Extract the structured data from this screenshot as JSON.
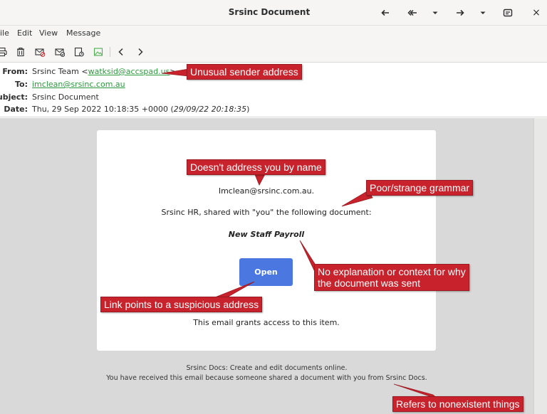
{
  "window": {
    "title": "Srsinc Document",
    "close_glyph": "×"
  },
  "menu": {
    "items": [
      "ile",
      "Edit",
      "View",
      "Message"
    ]
  },
  "headers": {
    "from_label": "From:",
    "from_name": "Srsinc Team <",
    "from_address": "watksid@accspad.us",
    "from_suffix": ">",
    "to_label": "To:",
    "to_address": "imclean@srsinc.com.au",
    "subject_label": "Subject:",
    "subject_value": "Srsinc Document",
    "date_label": "Date:",
    "date_value": "Thu, 29 Sep 2022 10:18:35 +0000 (",
    "date_local": "29/09/22 20:18:35",
    "date_suffix": ")"
  },
  "message": {
    "greeting": "Imclean@srsinc.com.au.",
    "line": "Srsinc HR, shared with \"you\" the following document:",
    "doc_name": "New Staff Payroll",
    "button_label": "Open",
    "grant_text": "This email grants access to this item.",
    "footer_1": "Srsinc Docs: Create and edit documents online.",
    "footer_2": "You have received this email because someone shared a document with you from Srsinc Docs."
  },
  "annotations": {
    "sender": "Unusual sender address",
    "name": "Doesn't address you by name",
    "grammar": "Poor/strange grammar",
    "context_1": "No explanation or context for why",
    "context_2": "the document was sent",
    "link": "Link points to a suspicious address",
    "nonexistent": "Refers to nonexistent things"
  },
  "colors": {
    "annotation": "#c8232c",
    "link": "#2a9a3d",
    "button": "#4a78e0"
  }
}
